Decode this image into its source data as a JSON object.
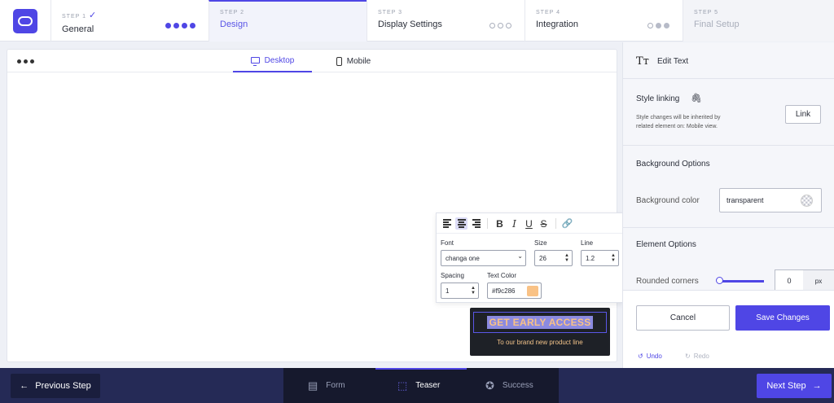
{
  "steps": [
    {
      "num": "STEP 1",
      "label": "General",
      "check": "✓"
    },
    {
      "num": "STEP 2",
      "label": "Design"
    },
    {
      "num": "STEP 3",
      "label": "Display Settings"
    },
    {
      "num": "STEP 4",
      "label": "Integration"
    },
    {
      "num": "STEP 5",
      "label": "Final Setup"
    }
  ],
  "canvas": {
    "tabs": {
      "desktop": "Desktop",
      "mobile": "Mobile"
    }
  },
  "text_toolbar": {
    "font_label": "Font",
    "font_value": "changa one",
    "size_label": "Size",
    "size_value": "26",
    "line_label": "Line",
    "line_value": "1.2",
    "spacing_label": "Spacing",
    "spacing_value": "1",
    "color_label": "Text Color",
    "color_value": "#f9c286",
    "color_swatch": "#f9c286"
  },
  "teaser": {
    "title": "GET EARLY ACCESS",
    "subtitle": "To our brand new product line"
  },
  "panel": {
    "title": "Edit Text",
    "style_linking": {
      "title": "Style linking",
      "description_line1": "Style changes will be inherited by",
      "description_line2": "related element on: Mobile view.",
      "button": "Link"
    },
    "background": {
      "title": "Background Options",
      "color_label": "Background color",
      "color_value": "transparent"
    },
    "element": {
      "title": "Element Options",
      "rounded_label": "Rounded corners",
      "rounded_value": "0",
      "rounded_unit": "px"
    },
    "actions": {
      "cancel": "Cancel",
      "save": "Save Changes",
      "undo": "Undo",
      "redo": "Redo"
    }
  },
  "bottom": {
    "previous": "Previous Step",
    "next": "Next Step",
    "tabs": {
      "form": "Form",
      "teaser": "Teaser",
      "success": "Success"
    }
  }
}
